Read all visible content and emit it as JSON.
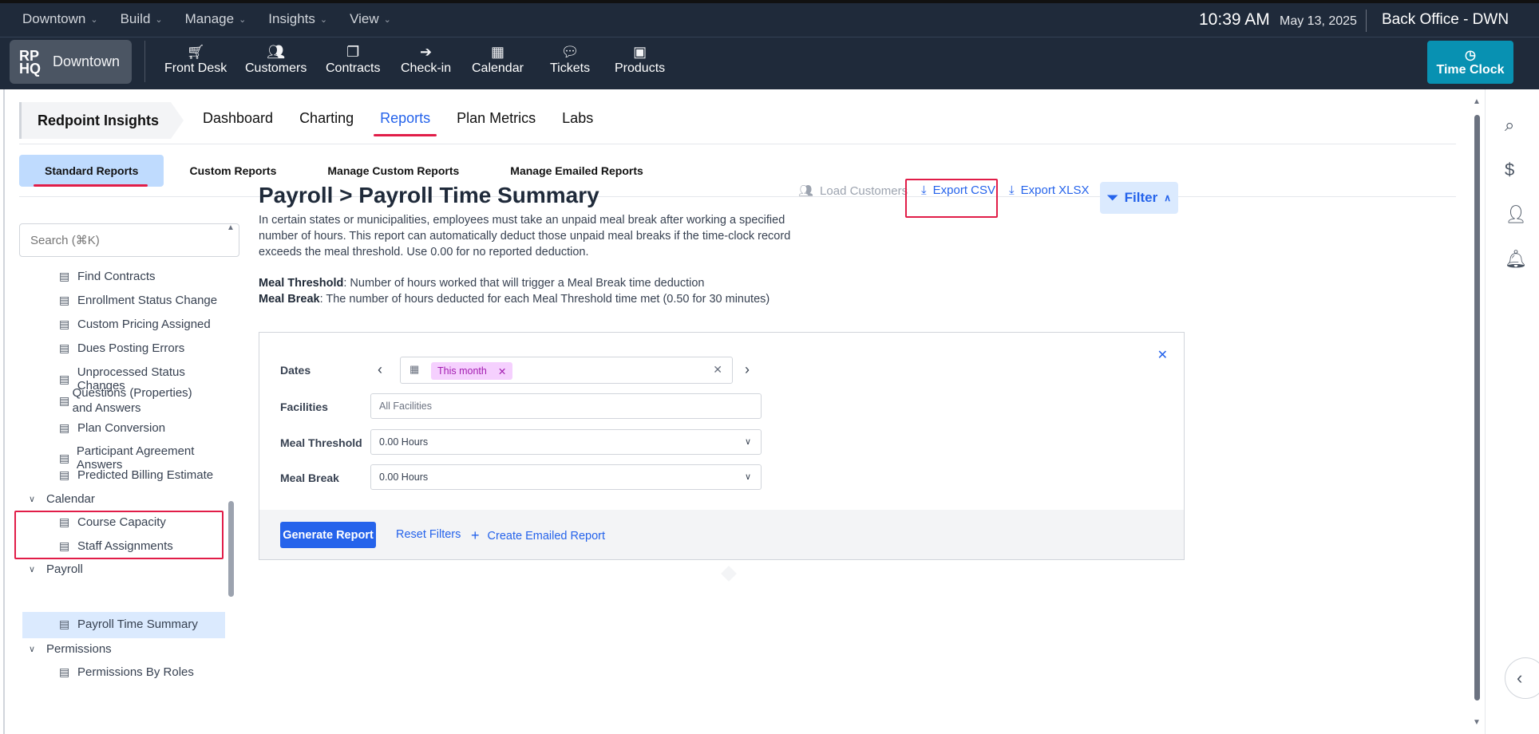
{
  "topmenu": [
    {
      "label": "Downtown",
      "active": false
    },
    {
      "label": "Build",
      "active": false
    },
    {
      "label": "Manage",
      "active": false
    },
    {
      "label": "Insights",
      "active": true
    },
    {
      "label": "View",
      "active": false
    }
  ],
  "status": {
    "time": "10:39 AM",
    "date": "May 13, 2025",
    "office": "Back Office - DWN"
  },
  "location": {
    "logo": "RP HQ",
    "name": "Downtown"
  },
  "nav": [
    {
      "label": "Front Desk",
      "icon": "cart-icon"
    },
    {
      "label": "Customers",
      "icon": "users-icon"
    },
    {
      "label": "Contracts",
      "icon": "contracts-icon"
    },
    {
      "label": "Check-in",
      "icon": "check-in-icon"
    },
    {
      "label": "Calendar",
      "icon": "calendar-icon"
    },
    {
      "label": "Tickets",
      "icon": "chat-icon"
    },
    {
      "label": "Products",
      "icon": "box-icon"
    }
  ],
  "timeclock": {
    "label": "Time Clock",
    "color": "#0891b2"
  },
  "breadcrumb": "Redpoint Insights",
  "tabs": [
    "Dashboard",
    "Charting",
    "Reports",
    "Plan Metrics",
    "Labs"
  ],
  "active_tab": "Reports",
  "subtabs": [
    "Standard Reports",
    "Custom Reports",
    "Manage Custom Reports",
    "Manage Emailed Reports"
  ],
  "search": {
    "placeholder": "Search (⌘K)"
  },
  "tree": {
    "items_a": [
      "Find Contracts",
      "Enrollment Status Change",
      "Custom Pricing Assigned",
      "Dues Posting Errors",
      "Unprocessed Status Changes",
      "Questions (Properties) and Answers",
      "Plan Conversion",
      "Participant Agreement Answers",
      "Predicted Billing Estimate"
    ],
    "group_calendar": "Calendar",
    "items_calendar": [
      "Course Capacity",
      "Staff Assignments"
    ],
    "group_payroll": "Payroll",
    "items_payroll": [
      "Payroll Time Summary"
    ],
    "group_permissions": "Permissions",
    "items_permissions": [
      "Permissions By Roles"
    ]
  },
  "page": {
    "title": "Payroll > Payroll Time Summary",
    "description": "In certain states or municipalities, employees must take an unpaid meal break after working a specified number of hours. This report can automatically deduct those unpaid meal breaks if the time-clock record exceeds the meal threshold. Use 0.00 for no reported deduction.",
    "def1_term": "Meal Threshold",
    "def1_text": ": Number of hours worked that will trigger a Meal Break time deduction",
    "def2_term": "Meal Break",
    "def2_text": ": The number of hours deducted for each Meal Threshold time met (0.50 for 30 minutes)"
  },
  "actions": {
    "load": "Load Customers",
    "csv": "Export CSV",
    "xlsx": "Export XLSX",
    "filter": "Filter"
  },
  "filters": {
    "dates_label": "Dates",
    "dates_chip": "This month",
    "facilities_label": "Facilities",
    "facilities_placeholder": "All Facilities",
    "threshold_label": "Meal Threshold",
    "threshold_value": "0.00 Hours",
    "break_label": "Meal Break",
    "break_value": "0.00 Hours"
  },
  "buttons": {
    "generate": "Generate Report",
    "reset": "Reset Filters",
    "create": "Create Emailed Report"
  },
  "colors": {
    "accent": "#2563eb",
    "highlight": "#e11d48",
    "nav_bg": "#1f2a3a"
  }
}
